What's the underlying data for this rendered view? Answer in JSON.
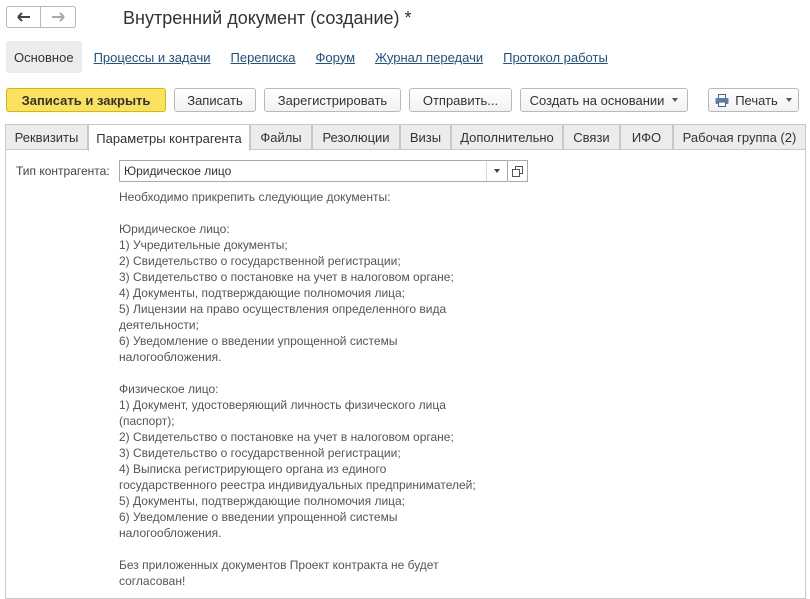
{
  "window": {
    "title": "Внутренний документ (создание) *"
  },
  "nav": {
    "back_icon": "arrow-left-icon",
    "forward_icon": "arrow-right-icon"
  },
  "sections": {
    "active": "Основное",
    "links": [
      "Процессы и задачи",
      "Переписка",
      "Форум",
      "Журнал передачи",
      "Протокол работы"
    ]
  },
  "toolbar": {
    "save_close": "Записать и закрыть",
    "save": "Записать",
    "register": "Зарегистрировать",
    "send": "Отправить...",
    "create_based": "Создать на основании",
    "print": "Печать"
  },
  "tabs": [
    "Реквизиты",
    "Параметры контрагента",
    "Файлы",
    "Резолюции",
    "Визы",
    "Дополнительно",
    "Связи",
    "ИФО",
    "Рабочая группа (2)"
  ],
  "active_tab_index": 1,
  "contractor": {
    "type_label": "Тип контрагента:",
    "type_value": "Юридическое лицо"
  },
  "note_lines": [
    "Необходимо прикрепить следующие документы:",
    "",
    "Юридическое лицо:",
    "1) Учредительные документы;",
    "2) Свидетельство о государственной регистрации;",
    "3) Свидетельство о постановке на учет в налоговом органе;",
    "4) Документы, подтверждающие полномочия лица;",
    "5) Лицензии на право осуществления определенного вида",
    "деятельности;",
    "6) Уведомление о введении упрощенной системы",
    "налогообложения.",
    "",
    "Физическое лицо:",
    "1) Документ, удостоверяющий личность физического лица",
    "(паспорт);",
    "2) Свидетельство о постановке на учет в налоговом органе;",
    "3) Свидетельство о государственной регистрации;",
    "4) Выписка регистрирующего органа из единого",
    "государственного реестра индивидуальных предпринимателей;",
    "5) Документы, подтверждающие полномочия лица;",
    "6) Уведомление о введении упрощенной системы",
    "налогообложения.",
    "",
    "Без приложенных документов Проект контракта не будет",
    "согласован!"
  ],
  "colors": {
    "primary_button": "#fbe25e",
    "link": "#1d4f91",
    "note_text": "#555555"
  }
}
